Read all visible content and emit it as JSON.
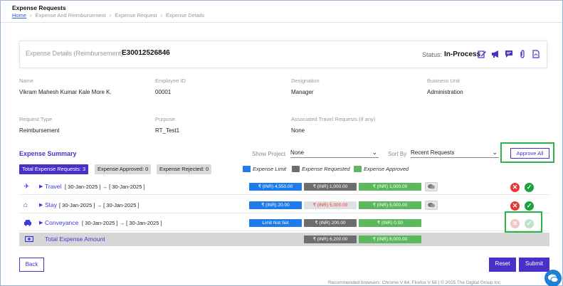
{
  "header": {
    "title": "Expense Requests",
    "breadcrumb": [
      "Home",
      "Expense And Reimbursement",
      "Expense Request",
      "Expense Details"
    ]
  },
  "details": {
    "label": "Expense Details (Reimbursement):",
    "id": "E30012526846",
    "status_label": "Status:",
    "status_value": "In-Process",
    "icons": [
      "edit-icon",
      "megaphone-icon",
      "comment-icon",
      "attachment-icon",
      "pdf-icon"
    ]
  },
  "info": {
    "name_label": "Name",
    "name": "Vikram Mahesh Kumar Kale More K.",
    "empid_label": "Employee ID",
    "empid": "00001",
    "designation_label": "Designation",
    "designation": "Manager",
    "bu_label": "Business Unit",
    "bu": "Administration",
    "reqtype_label": "Request Type",
    "reqtype": "Reimbursement",
    "purpose_label": "Purpose",
    "purpose": "RT_Test1",
    "assoc_label": "Associated Travel Requests (If any)",
    "assoc": "None"
  },
  "summary": {
    "title": "Expense Summary",
    "show_project_label": "Show Project",
    "show_project_value": "None",
    "sort_by_label": "Sort By",
    "sort_by_value": "Recent Requests",
    "approve_all": "Approve All",
    "pill_total": "Total Expense Requests: 3",
    "pill_approved": "Expense Approved: 0",
    "pill_rejected": "Expense Rejected: 0",
    "legend_limit": "Expense Limit",
    "legend_requested": "Expense Requested",
    "legend_approved": "Expense Approved"
  },
  "rows": [
    {
      "name": "Travel",
      "dates": "[ 30-Jan-2025 ] → [ 30-Jan-2025 ]",
      "limit": "₹ (INR) 4,550.00",
      "requested": "₹ (INR) 1,000.00",
      "approved": "₹ (INR) 1,000.00"
    },
    {
      "name": "Stay",
      "dates": "[ 30-Jan-2025 ] → [ 30-Jan-2025 ]",
      "limit": "₹ (INR) 20.00",
      "requested": "₹ (INR) 5,000.00",
      "approved": "₹ (INR) 5,000.00"
    },
    {
      "name": "Conveyance",
      "dates": "[ 30-Jan-2025 ] → [ 30-Jan-2025 ]",
      "limit": "Limit Not Set",
      "requested": "₹ (INR) 200.00",
      "approved": "₹ (INR) 0.00"
    }
  ],
  "total": {
    "label": "Total Expense Amount",
    "requested": "₹ (INR) 6,200.00",
    "approved": "₹ (INR) 6,000.00"
  },
  "actions": {
    "back": "Back",
    "reset": "Reset",
    "submit": "Submit"
  },
  "footer": "Recommended browsers: Chrome V 64, Firefox V 58  |  © 2025 The Digital Group Inc",
  "colors": {
    "accent": "#4b2fc9",
    "limit": "#1f7bea",
    "requested": "#6d6d6d",
    "approved": "#5cb85c",
    "reject": "#e53935",
    "approve": "#1aa33a"
  }
}
